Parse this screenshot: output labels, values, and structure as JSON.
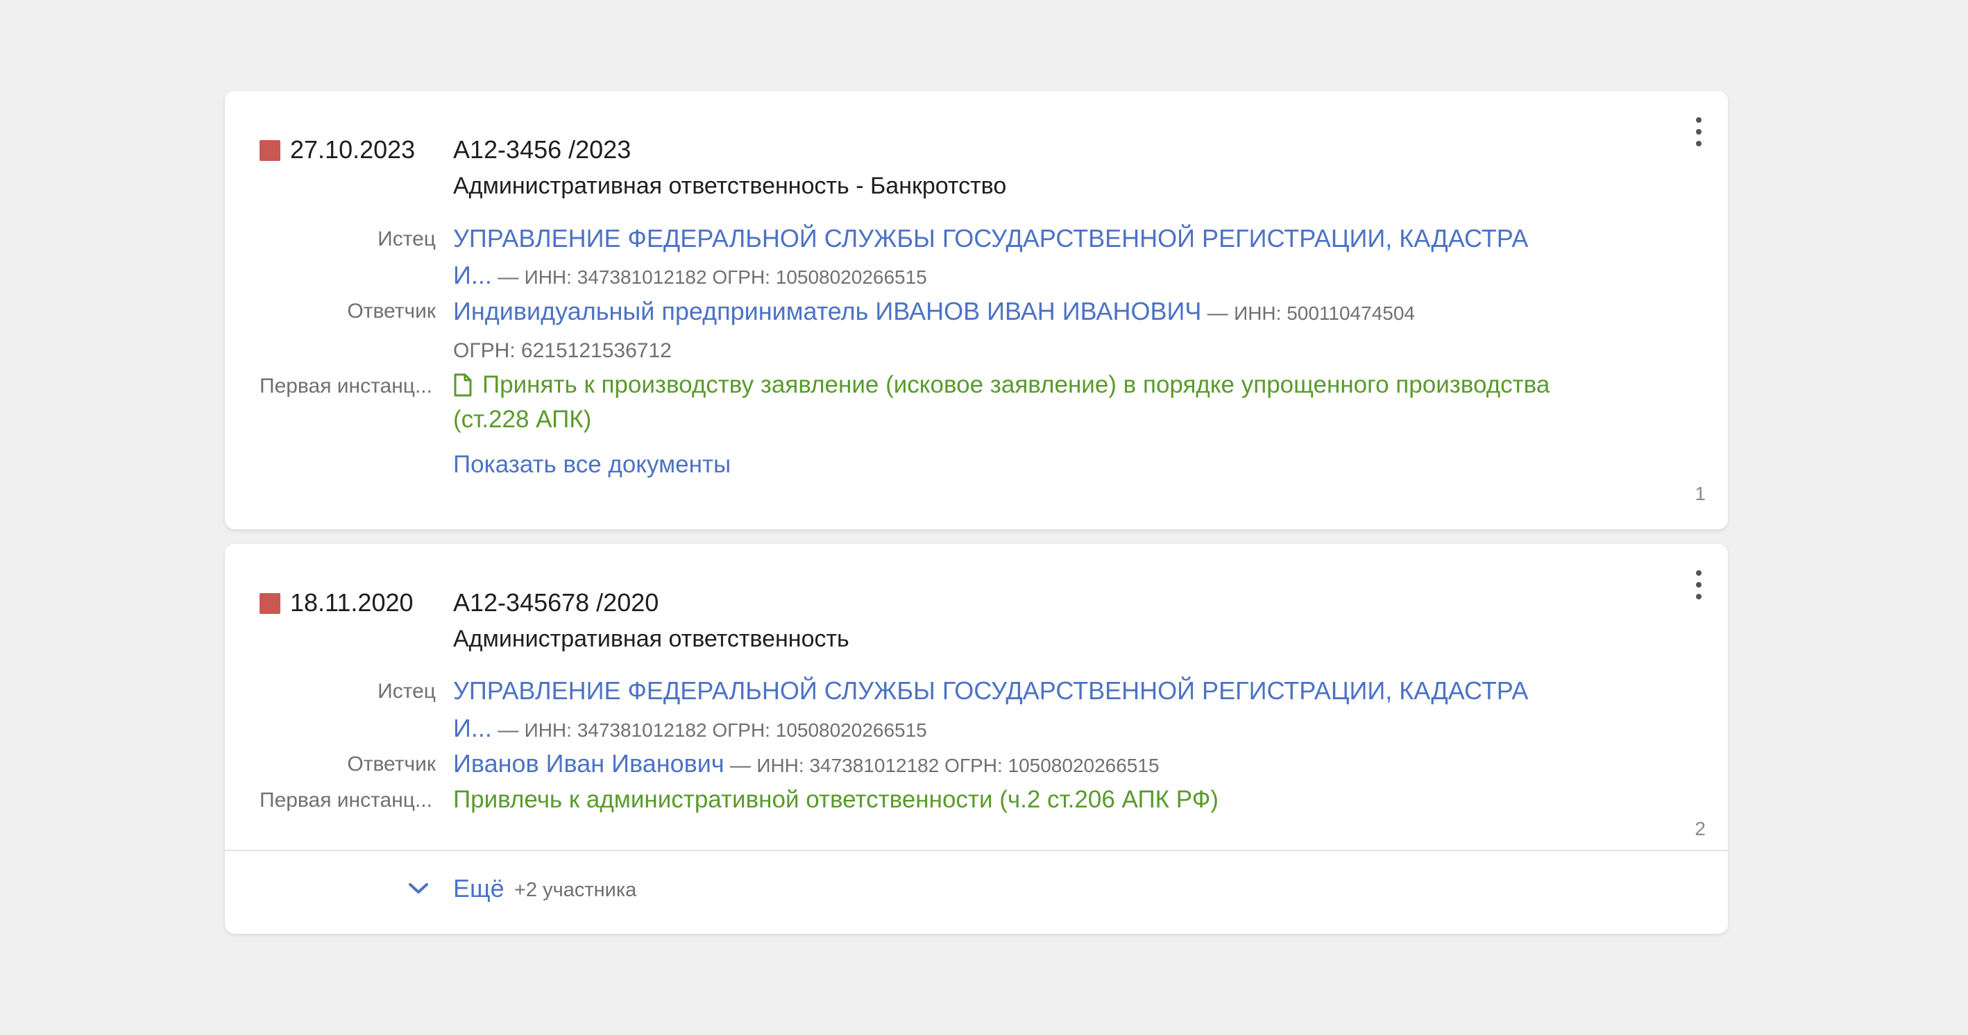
{
  "colors": {
    "marker": "#c95752",
    "link": "#4c72c4",
    "document": "#5a9a2c",
    "muted": "#707070"
  },
  "labels": {
    "plaintiff": "Истец",
    "defendant": "Ответчик",
    "first_instance": "Первая инстанц..."
  },
  "cases": [
    {
      "date": "27.10.2023",
      "case_number": "А12-3456 /2023",
      "category": "Административная ответственность - Банкротство",
      "plaintiff": {
        "name_line1": "УПРАВЛЕНИЕ ФЕДЕРАЛЬНОЙ СЛУЖБЫ ГОСУДАРСТВЕННОЙ РЕГИСТРАЦИИ, КАДАСТРА",
        "name_line2": "И...",
        "inn": "ИНН: 347381012182",
        "ogrn": "ОГРН: 10508020266515"
      },
      "defendant": {
        "name": "Индивидуальный предприниматель ИВАНОВ ИВАН ИВАНОВИЧ",
        "inn": "ИНН: 500110474504",
        "ogrn": "ОГРН: 6215121536712"
      },
      "document": {
        "icon": "document-icon",
        "line1": "Принять к производству заявление (исковое заявление) в порядке упрощенного производства",
        "line2": "(ст.228 АПК)"
      },
      "show_all_documents": "Показать все документы",
      "counter": "1"
    },
    {
      "date": "18.11.2020",
      "case_number": "А12-345678 /2020",
      "category": "Административная ответственность",
      "plaintiff": {
        "name_line1": "УПРАВЛЕНИЕ ФЕДЕРАЛЬНОЙ СЛУЖБЫ ГОСУДАРСТВЕННОЙ РЕГИСТРАЦИИ, КАДАСТРА",
        "name_line2": "И...",
        "inn": "ИНН: 347381012182",
        "ogrn": "ОГРН: 10508020266515"
      },
      "defendant": {
        "name": "Иванов Иван Иванович",
        "inn": "ИНН: 347381012182",
        "ogrn": "ОГРН: 10508020266515"
      },
      "document": {
        "line1": "Привлечь к административной ответственности (ч.2 ст.206 АПК РФ)"
      },
      "counter": "2",
      "more": {
        "icon": "chevron-down-icon",
        "label": "Ещё",
        "extra": "+2 участника"
      }
    }
  ]
}
